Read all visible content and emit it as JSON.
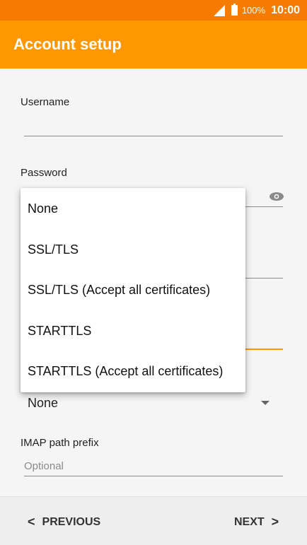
{
  "status_bar": {
    "battery": "100%",
    "time": "10:00"
  },
  "header": {
    "title": "Account setup"
  },
  "form": {
    "username_label": "Username",
    "password_label": "Password",
    "security_value": "None",
    "imap_prefix_label": "IMAP path prefix",
    "imap_prefix_placeholder": "Optional"
  },
  "dropdown": {
    "options": [
      "None",
      "SSL/TLS",
      "SSL/TLS (Accept all certificates)",
      "STARTTLS",
      "STARTTLS (Accept all certificates)"
    ]
  },
  "nav": {
    "previous": "PREVIOUS",
    "next": "NEXT",
    "prev_icon": "<",
    "next_icon": ">"
  },
  "colors": {
    "status_bar": "#f57c00",
    "app_bar": "#ff9800",
    "accent": "#ff9800"
  }
}
